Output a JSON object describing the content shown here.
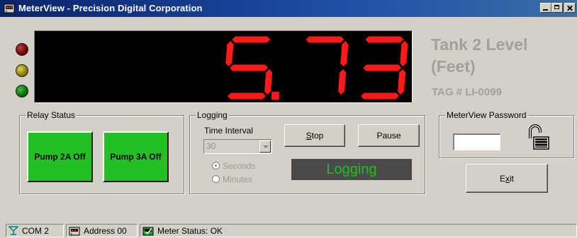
{
  "window": {
    "title": "MeterView - Precision Digital Corporation"
  },
  "display": {
    "value": "5.73",
    "digit_color": "#ff1a1a"
  },
  "tank": {
    "title": "Tank 2 Level\n(Feet)",
    "tag": "TAG # LI-0099"
  },
  "relay": {
    "legend": "Relay Status",
    "pump_2a": "Pump 2A Off",
    "pump_3a": "Pump 3A Off",
    "pump_color": "#22c022"
  },
  "logging": {
    "legend": "Logging",
    "time_interval_label": "Time Interval",
    "interval_value": "30",
    "seconds_label": "Seconds",
    "minutes_label": "Minutes",
    "selected_unit": "Seconds",
    "stop_label_pre": "",
    "stop_label_u": "S",
    "stop_label_post": "top",
    "pause_label": "Pause",
    "status_text": "Logging"
  },
  "password": {
    "legend": "MeterView Password",
    "value": ""
  },
  "exit": {
    "label_pre": "E",
    "label_u": "x",
    "label_post": "it"
  },
  "statusbar": {
    "com": "COM 2",
    "address": "Address 00",
    "meter_status": "Meter Status: OK"
  },
  "icons": {
    "app": "meterview-app-icon",
    "com": "com-port-icon",
    "address": "address-icon",
    "meter_status": "meter-status-icon",
    "lock": "unlocked-padlock-icon"
  }
}
